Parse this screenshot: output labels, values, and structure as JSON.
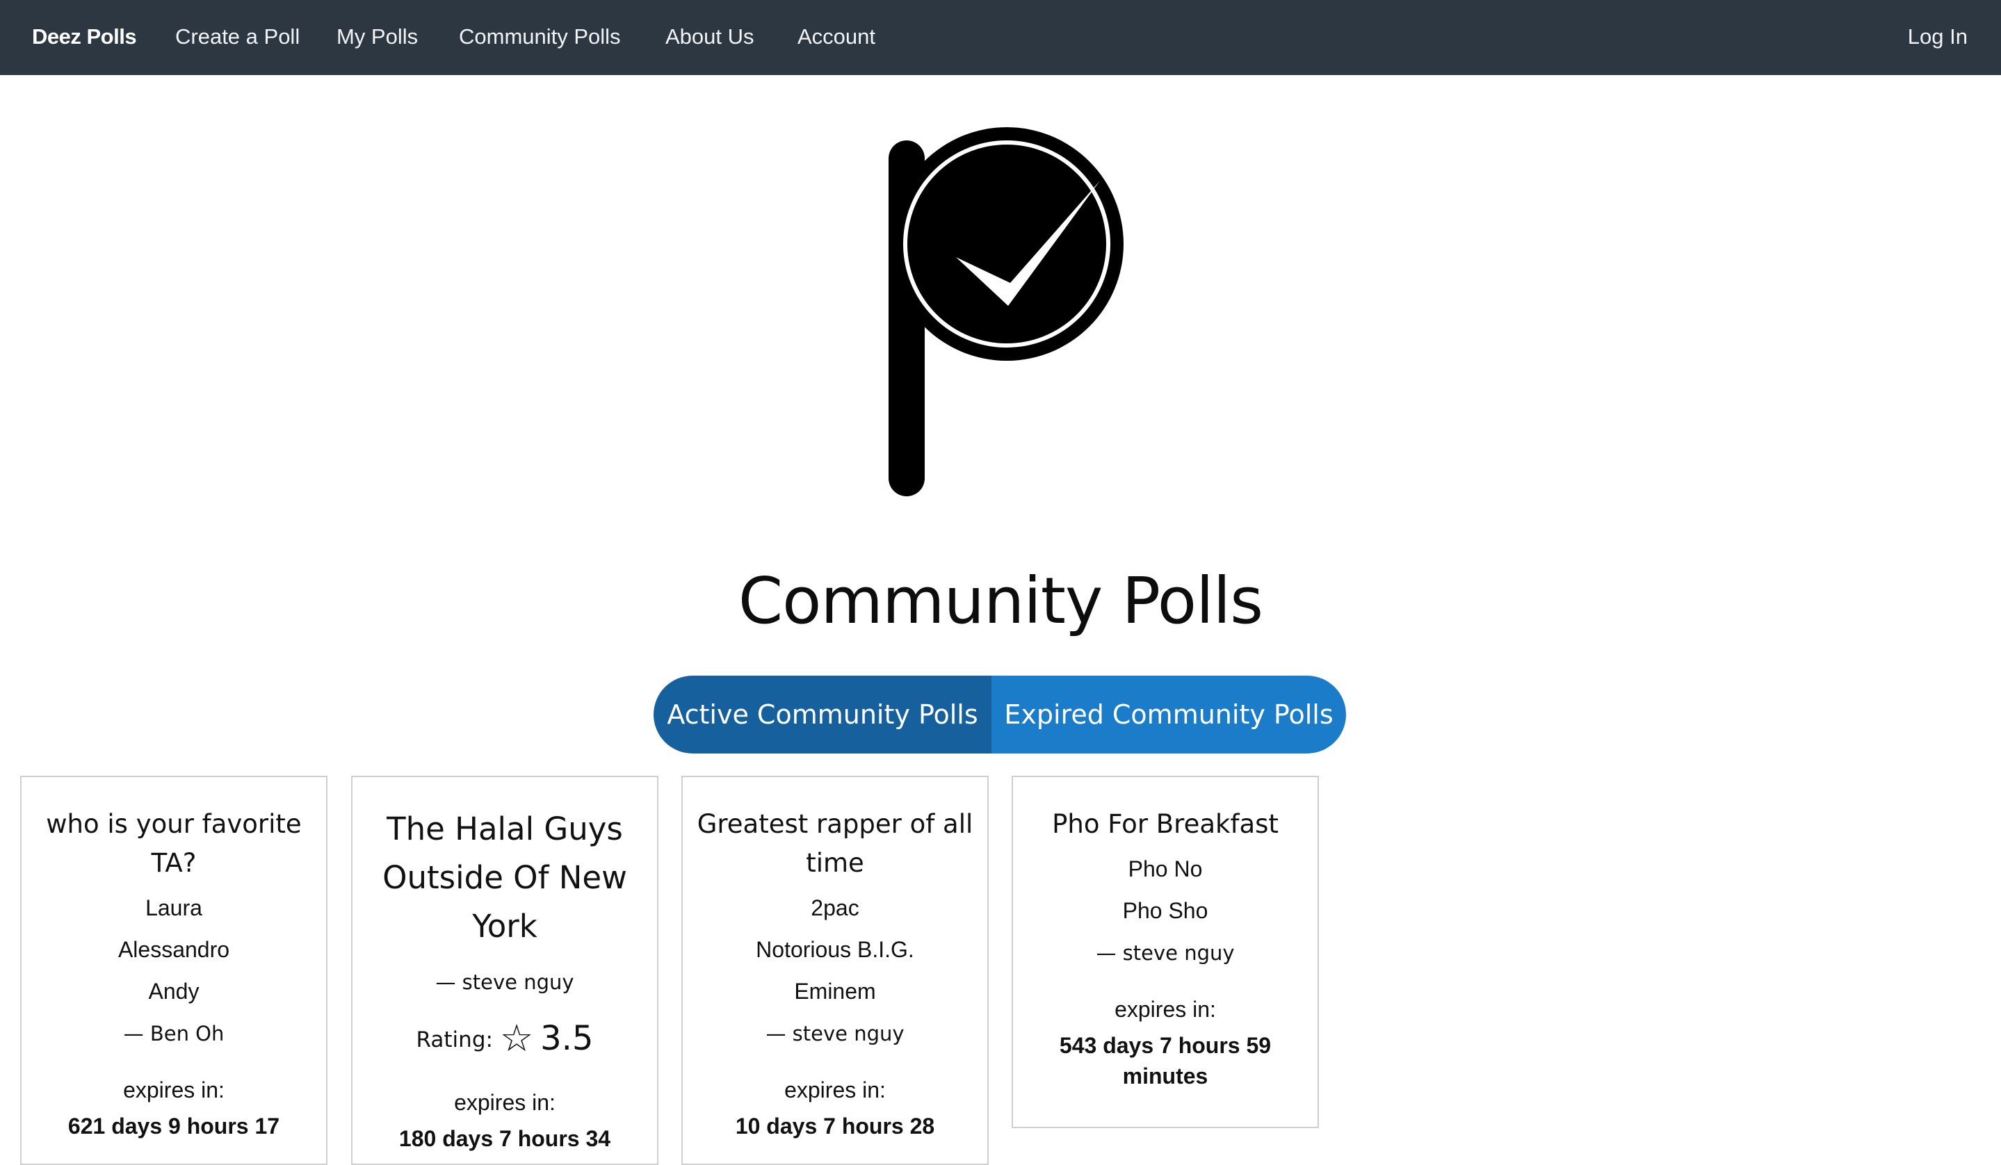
{
  "nav": {
    "brand": "Deez Polls",
    "items": [
      "Create a Poll",
      "My Polls",
      "Community Polls",
      "About Us",
      "Account"
    ],
    "login": "Log In"
  },
  "logo": {
    "icon": "poll-checkmark-logo"
  },
  "page_title": "Community Polls",
  "tabs": [
    {
      "label": "Active Community Polls",
      "active": true
    },
    {
      "label": "Expired Community Polls",
      "active": false
    }
  ],
  "colors": {
    "navbar": "#2d3742",
    "tab_active": "#16609e",
    "tab_inactive": "#1b7cc9"
  },
  "cards": [
    {
      "title": "who is your favorite TA?",
      "options": [
        "Laura",
        "Alessandro",
        "Andy"
      ],
      "author": "— Ben Oh",
      "expires_label": "expires in:",
      "expires_value": "621 days 9 hours 17"
    },
    {
      "title": "The Halal Guys Outside Of New York",
      "author": "— steve nguy",
      "rating_label": "Rating:",
      "rating_value": "3.5",
      "expires_label": "expires in:",
      "expires_value": "180 days 7 hours 34"
    },
    {
      "title": "Greatest rapper of all time",
      "options": [
        "2pac",
        "Notorious B.I.G.",
        "Eminem"
      ],
      "author": "— steve nguy",
      "expires_label": "expires in:",
      "expires_value": "10 days 7 hours 28"
    },
    {
      "title": "Pho For Breakfast",
      "options": [
        "Pho No",
        "Pho Sho"
      ],
      "author": "— steve nguy",
      "expires_label": "expires in:",
      "expires_value": "543 days 7 hours 59 minutes"
    }
  ]
}
